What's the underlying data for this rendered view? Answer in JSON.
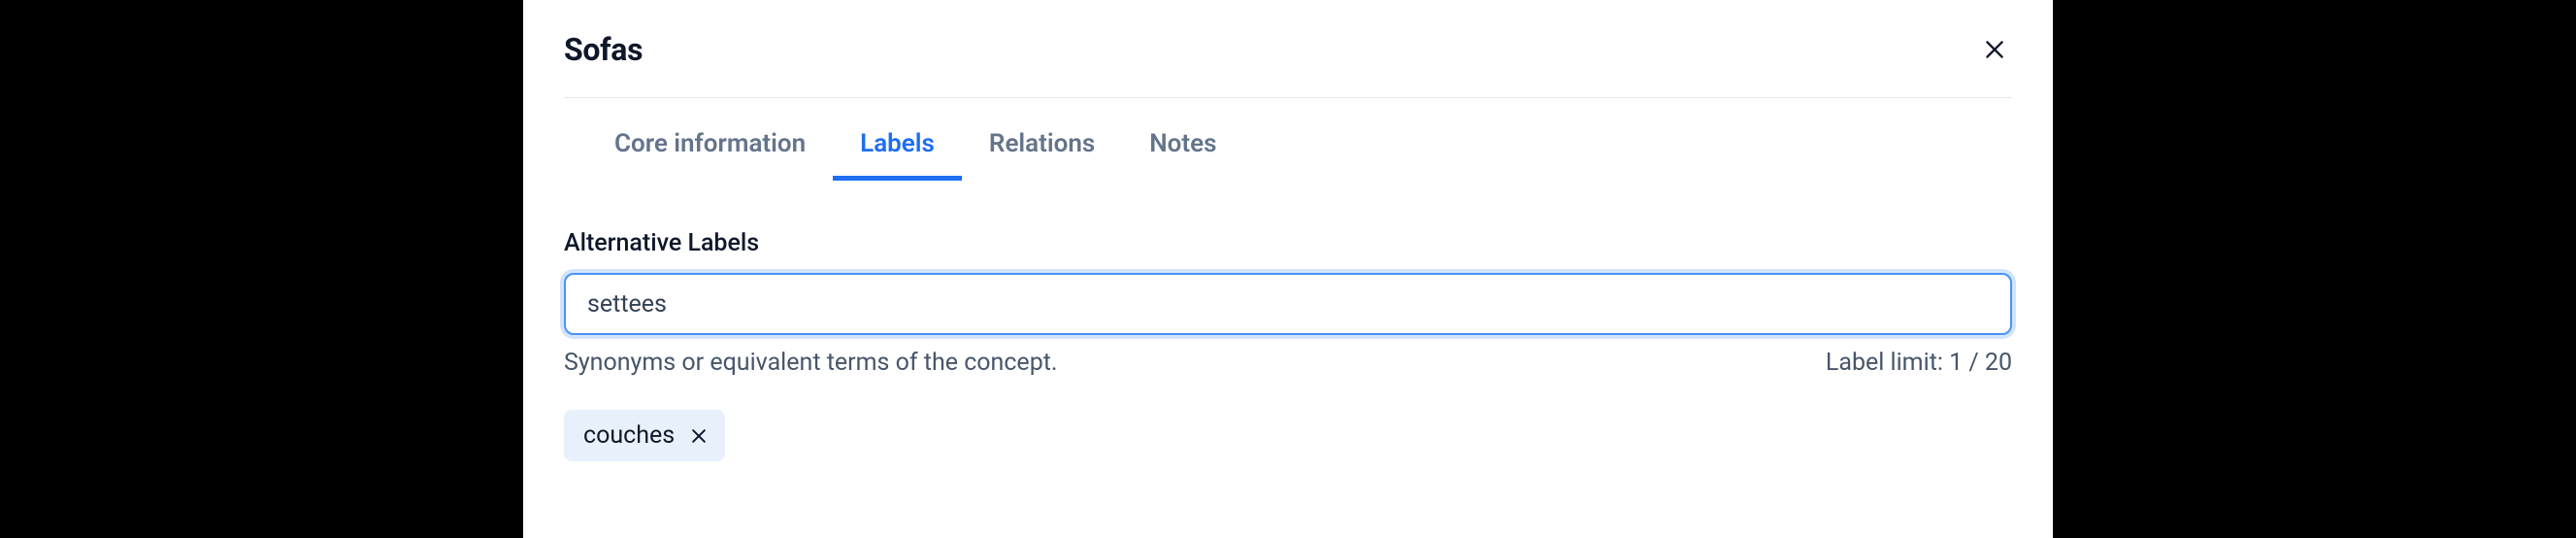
{
  "header": {
    "title": "Sofas"
  },
  "tabs": {
    "items": [
      {
        "label": "Core information",
        "active": false
      },
      {
        "label": "Labels",
        "active": true
      },
      {
        "label": "Relations",
        "active": false
      },
      {
        "label": "Notes",
        "active": false
      }
    ]
  },
  "section": {
    "heading": "Alternative Labels",
    "input_value": "settees",
    "helper_text": "Synonyms or equivalent terms of the concept.",
    "limit_text": "Label limit: 1 / 20"
  },
  "tags": [
    {
      "label": "couches"
    }
  ]
}
